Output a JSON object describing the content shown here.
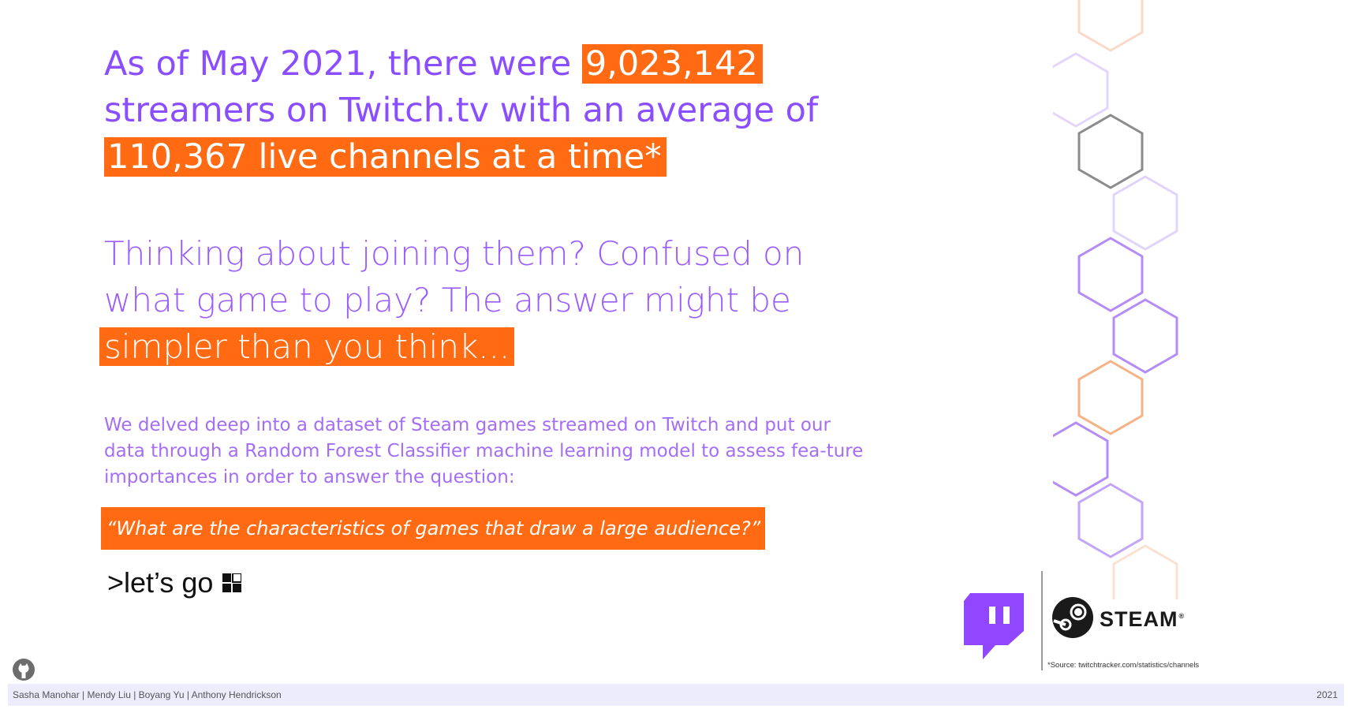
{
  "headline": {
    "part1": "As of May 2021, there were ",
    "streamers_count": "9,023,142",
    "part2": " streamers on Twitch.tv with an average of ",
    "live_channels": "110,367 live channels at a time*"
  },
  "hook": {
    "text": "Thinking about joining them? Confused on what game to play? The answer might be ",
    "highlight": "simpler than you think..."
  },
  "description": "We delved deep into a dataset of Steam games streamed on Twitch and put our data through a Random Forest Classifier machine learning model to assess fea-ture importances in order to answer the question:",
  "question": "“What are the characteristics of games that draw a large audience?”",
  "lets_go_label": ">let’s go",
  "logos": {
    "twitch_icon": "twitch-icon",
    "steam_word": "STEAM",
    "steam_reg": "®"
  },
  "source_note": "*Source: twitchtracker.com/statistics/channels",
  "footer": {
    "authors": "Sasha Manohar | Mendy Liu | Boyang Yu | Anthony Hendrickson",
    "year": "2021"
  },
  "colors": {
    "accent_orange": "#ff6a13",
    "purple": "#8a4dff",
    "footer_bg": "#ececfc"
  }
}
